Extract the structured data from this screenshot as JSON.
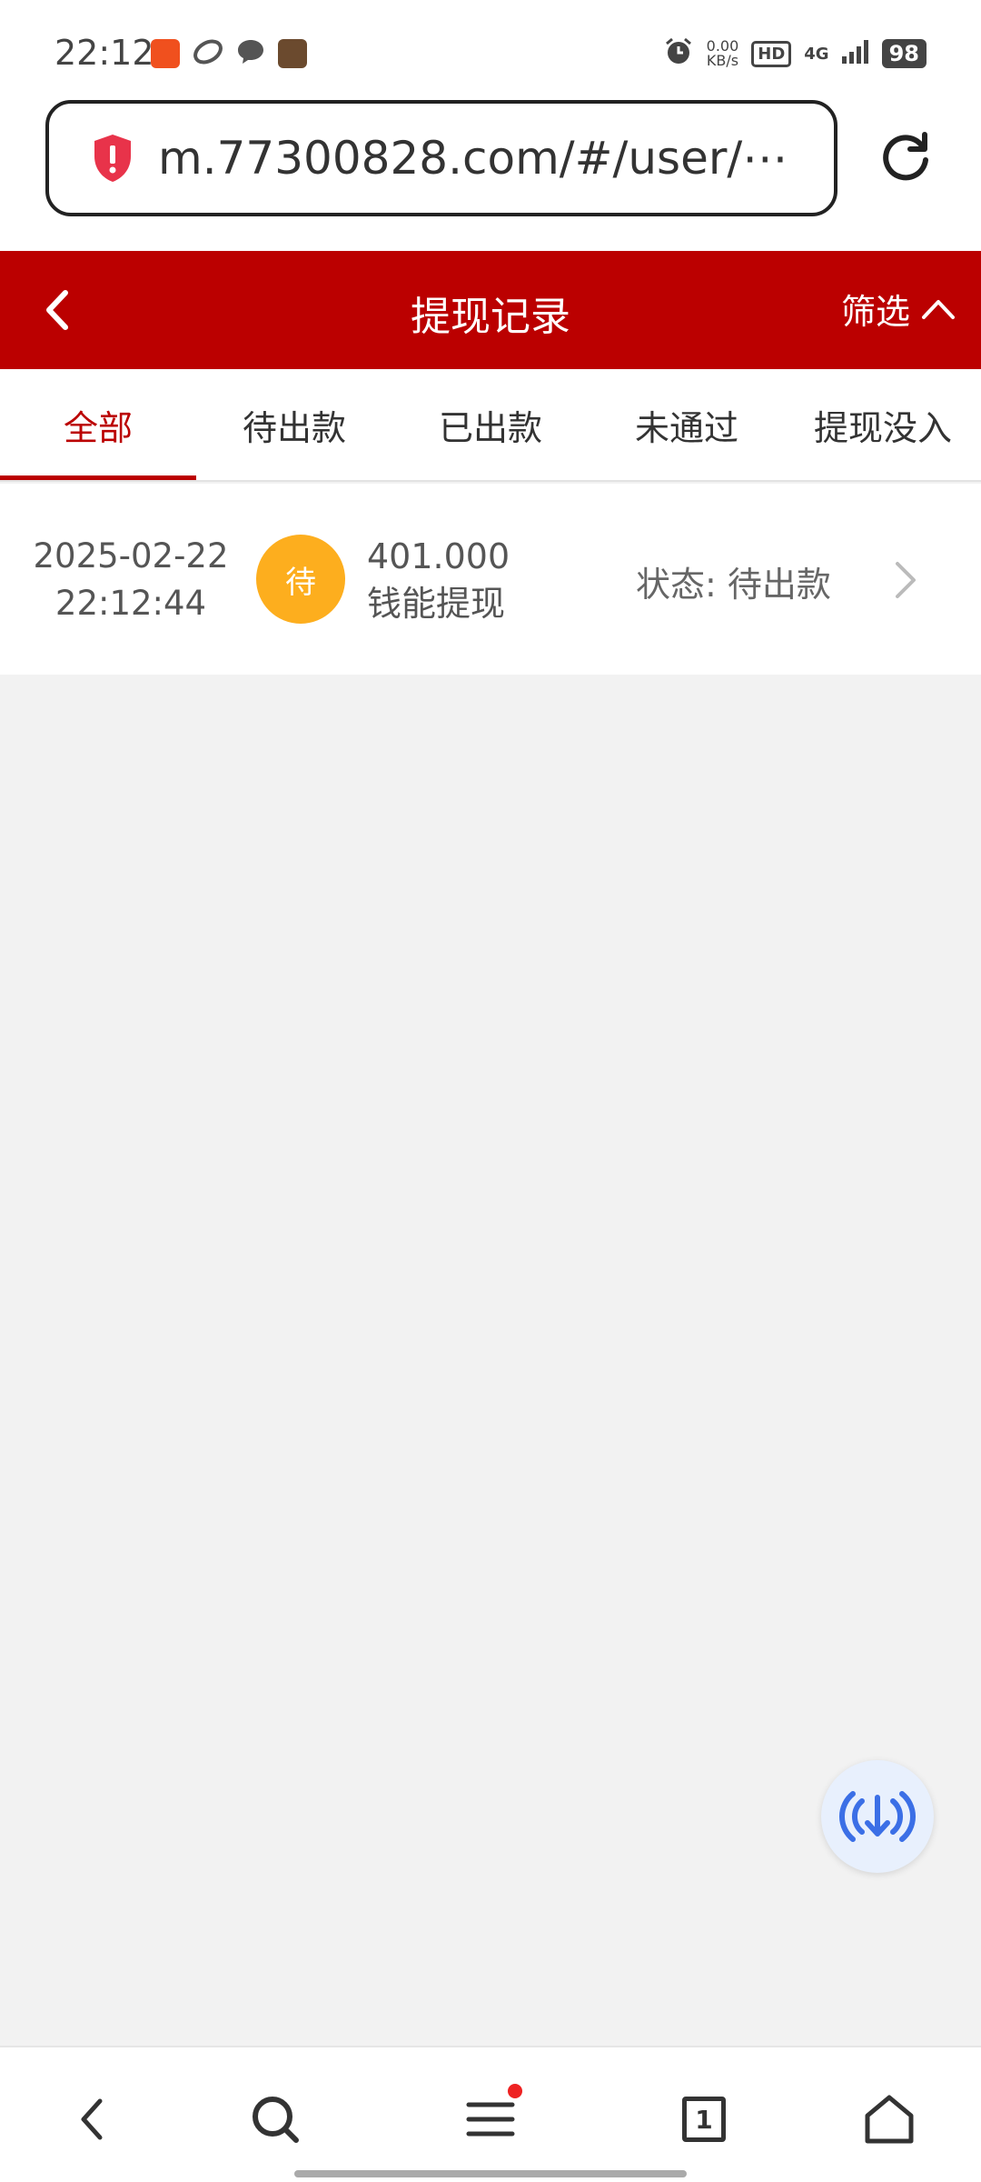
{
  "status_bar": {
    "time": "22:12",
    "net_speed_value": "0.00",
    "net_speed_unit": "KB/s",
    "hd_label": "HD",
    "network": "4G",
    "battery": "98"
  },
  "browser": {
    "url": "m.77300828.com/#/user/⋯"
  },
  "header": {
    "title": "提现记录",
    "filter_label": "筛选"
  },
  "tabs": [
    {
      "label": "全部",
      "active": true
    },
    {
      "label": "待出款",
      "active": false
    },
    {
      "label": "已出款",
      "active": false
    },
    {
      "label": "未通过",
      "active": false
    },
    {
      "label": "提现没入",
      "active": false
    }
  ],
  "records": [
    {
      "date": "2025-02-22",
      "time": "22:12:44",
      "badge": "待",
      "amount": "401.000",
      "type": "钱能提现",
      "status_label": "状态:",
      "status_value": "待出款"
    }
  ],
  "bottom_nav": {
    "tab_count": "1"
  },
  "colors": {
    "brand_red": "#bb0000",
    "badge_orange": "#fdae1e",
    "float_blue": "#3b6fe6"
  }
}
